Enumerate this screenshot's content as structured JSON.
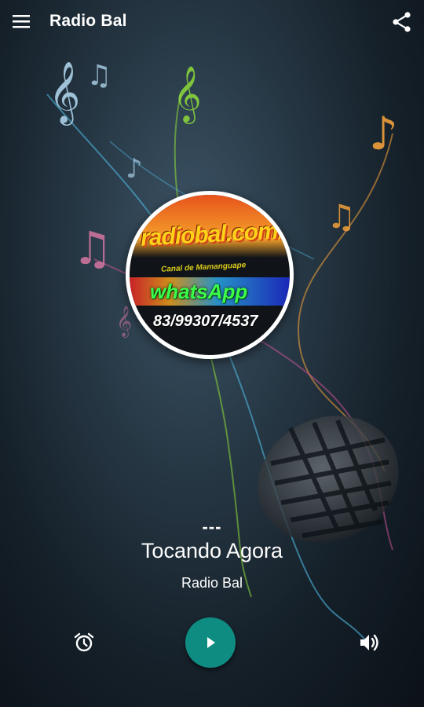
{
  "app": {
    "title": "Radio Bal"
  },
  "toolbar": {
    "menu_icon": "hamburger-menu-icon",
    "share_icon": "share-icon"
  },
  "logo": {
    "line1": "radiobal.com.br",
    "line2": "Canal de Mamanguape",
    "line3": "whatsApp",
    "line4": "83/99307/4537"
  },
  "player": {
    "track": "---",
    "status": "Tocando Agora",
    "station": "Radio Bal"
  },
  "controls": {
    "alarm_icon": "alarm-clock-icon",
    "play_icon": "play-icon",
    "volume_icon": "volume-icon",
    "accent_color": "#0f8c82"
  }
}
